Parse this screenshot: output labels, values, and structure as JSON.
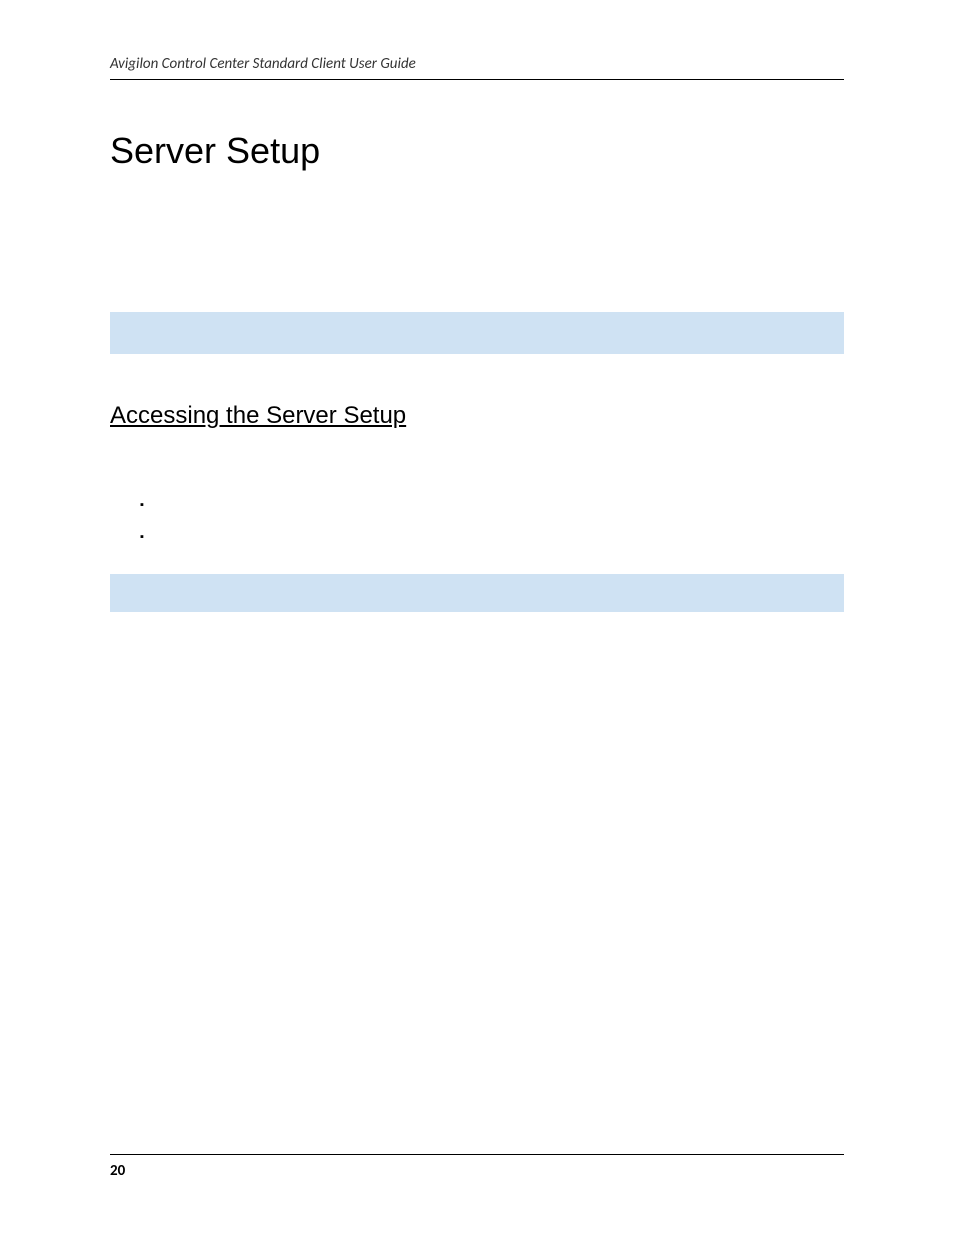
{
  "header": {
    "text": "Avigilon Control Center Standard Client User Guide"
  },
  "chapter": {
    "title": "Server Setup"
  },
  "section": {
    "heading": "Accessing the Server Setup"
  },
  "footer": {
    "pageNumber": "20"
  }
}
